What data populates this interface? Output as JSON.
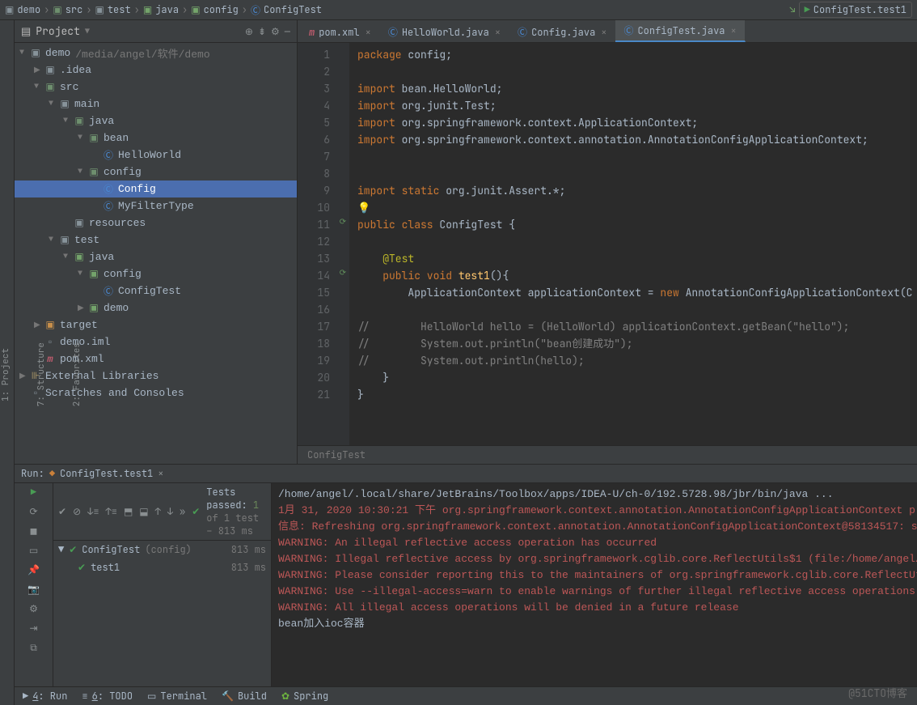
{
  "breadcrumb": [
    "demo",
    "src",
    "test",
    "java",
    "config",
    "ConfigTest"
  ],
  "top_right_label": "ConfigTest.test1",
  "project": {
    "title": "Project",
    "tree": [
      {
        "depth": 0,
        "arrow": "▼",
        "icon": "folder",
        "label": "demo",
        "hint": "/media/angel/软件/demo"
      },
      {
        "depth": 1,
        "arrow": "▶",
        "icon": "folder",
        "label": ".idea"
      },
      {
        "depth": 1,
        "arrow": "▼",
        "icon": "folder-src",
        "label": "src"
      },
      {
        "depth": 2,
        "arrow": "▼",
        "icon": "folder",
        "label": "main"
      },
      {
        "depth": 3,
        "arrow": "▼",
        "icon": "folder-src",
        "label": "java"
      },
      {
        "depth": 4,
        "arrow": "▼",
        "icon": "folder-src",
        "label": "bean"
      },
      {
        "depth": 5,
        "arrow": "",
        "icon": "class",
        "label": "HelloWorld"
      },
      {
        "depth": 4,
        "arrow": "▼",
        "icon": "folder-src",
        "label": "config"
      },
      {
        "depth": 5,
        "arrow": "",
        "icon": "class",
        "label": "Config",
        "sel": true
      },
      {
        "depth": 5,
        "arrow": "",
        "icon": "class",
        "label": "MyFilterType"
      },
      {
        "depth": 3,
        "arrow": "",
        "icon": "folder-res",
        "label": "resources"
      },
      {
        "depth": 2,
        "arrow": "▼",
        "icon": "folder",
        "label": "test"
      },
      {
        "depth": 3,
        "arrow": "▼",
        "icon": "folder-test",
        "label": "java"
      },
      {
        "depth": 4,
        "arrow": "▼",
        "icon": "folder-test",
        "label": "config"
      },
      {
        "depth": 5,
        "arrow": "",
        "icon": "class",
        "label": "ConfigTest"
      },
      {
        "depth": 4,
        "arrow": "▶",
        "icon": "folder-test",
        "label": "demo"
      },
      {
        "depth": 1,
        "arrow": "▶",
        "icon": "folder-orange",
        "label": "target"
      },
      {
        "depth": 1,
        "arrow": "",
        "icon": "file",
        "label": "demo.iml"
      },
      {
        "depth": 1,
        "arrow": "",
        "icon": "maven",
        "label": "pom.xml"
      },
      {
        "depth": 0,
        "arrow": "▶",
        "icon": "lib",
        "label": "External Libraries"
      },
      {
        "depth": 0,
        "arrow": "",
        "icon": "file",
        "label": "Scratches and Consoles"
      }
    ]
  },
  "tabs": [
    {
      "icon": "maven",
      "label": "pom.xml"
    },
    {
      "icon": "class",
      "label": "HelloWorld.java"
    },
    {
      "icon": "class",
      "label": "Config.java"
    },
    {
      "icon": "class",
      "label": "ConfigTest.java",
      "active": true
    }
  ],
  "code_lines": [
    {
      "n": 1,
      "html": "<span class='kw'>package</span> config;"
    },
    {
      "n": 2,
      "html": ""
    },
    {
      "n": 3,
      "html": "<span class='kw'>import</span> bean.HelloWorld;",
      "fold": "⊖"
    },
    {
      "n": 4,
      "html": "<span class='kw'>import</span> org.junit.<span class='cls'>Test</span>;"
    },
    {
      "n": 5,
      "html": "<span class='kw'>import</span> org.springframework.context.ApplicationContext;"
    },
    {
      "n": 6,
      "html": "<span class='kw'>import</span> org.springframework.context.annotation.AnnotationConfigApplicationContext;"
    },
    {
      "n": 7,
      "html": ""
    },
    {
      "n": 8,
      "html": ""
    },
    {
      "n": 9,
      "html": "<span class='kw'>import static</span> org.junit.Assert.*;",
      "fold": "⊖"
    },
    {
      "n": 10,
      "html": "💡"
    },
    {
      "n": 11,
      "html": "<span class='kw'>public class</span> <span class='cls'>ConfigTest</span> {",
      "gut": "⟳"
    },
    {
      "n": 12,
      "html": ""
    },
    {
      "n": 13,
      "html": "    <span class='ann'>@Test</span>"
    },
    {
      "n": 14,
      "html": "    <span class='kw'>public void</span> <span class='mtd'>test1</span>(){",
      "gut": "⟳",
      "fold": "⊖"
    },
    {
      "n": 15,
      "html": "        ApplicationContext applicationContext = <span class='kw'>new</span> AnnotationConfigApplicationContext(C"
    },
    {
      "n": 16,
      "html": ""
    },
    {
      "n": 17,
      "html": "<span class='cmt'>//        HelloWorld hello = (HelloWorld) applicationContext.getBean(\"hello\");</span>"
    },
    {
      "n": 18,
      "html": "<span class='cmt'>//        System.out.println(\"bean创建成功\");</span>"
    },
    {
      "n": 19,
      "html": "<span class='cmt'>//        System.out.println(hello);</span>"
    },
    {
      "n": 20,
      "html": "    }"
    },
    {
      "n": 21,
      "html": "}"
    }
  ],
  "editor_breadcrumb": "ConfigTest",
  "run": {
    "title": "Run:",
    "config": "ConfigTest.test1",
    "tests_passed_prefix": "Tests passed:",
    "tests_passed_count": "1",
    "tests_passed_suffix": "of 1 test – 813 ms",
    "tree": [
      {
        "label": "ConfigTest",
        "hint": "(config)",
        "ms": "813 ms",
        "depth": 0
      },
      {
        "label": "test1",
        "ms": "813 ms",
        "depth": 1
      }
    ],
    "console": [
      {
        "cls": "normal",
        "t": "/home/angel/.local/share/JetBrains/Toolbox/apps/IDEA-U/ch-0/192.5728.98/jbr/bin/java ..."
      },
      {
        "cls": "normal",
        "t": ""
      },
      {
        "cls": "warn",
        "t": "1月 31, 2020 10:30:21 下午 org.springframework.context.annotation.AnnotationConfigApplicationContext p"
      },
      {
        "cls": "warn",
        "t": "信息: Refreshing org.springframework.context.annotation.AnnotationConfigApplicationContext@58134517: s"
      },
      {
        "cls": "warn",
        "t": "WARNING: An illegal reflective access operation has occurred"
      },
      {
        "cls": "warn",
        "t": "WARNING: Illegal reflective access by org.springframework.cglib.core.ReflectUtils$1 (file:/home/angel/"
      },
      {
        "cls": "warn",
        "t": "WARNING: Please consider reporting this to the maintainers of org.springframework.cglib.core.ReflectUt"
      },
      {
        "cls": "warn",
        "t": "WARNING: Use --illegal-access=warn to enable warnings of further illegal reflective access operations"
      },
      {
        "cls": "warn",
        "t": "WARNING: All illegal access operations will be denied in a future release"
      },
      {
        "cls": "normal",
        "t": "bean加入ioc容器"
      }
    ]
  },
  "statusbar": [
    {
      "icon": "▶",
      "label": "4: Run",
      "u": "4"
    },
    {
      "icon": "≡",
      "label": "6: TODO",
      "u": "6"
    },
    {
      "icon": "▭",
      "label": "Terminal"
    },
    {
      "icon": "🔨",
      "label": "Build"
    },
    {
      "icon": "✿",
      "label": "Spring"
    }
  ],
  "watermark": "@51CTO博客"
}
